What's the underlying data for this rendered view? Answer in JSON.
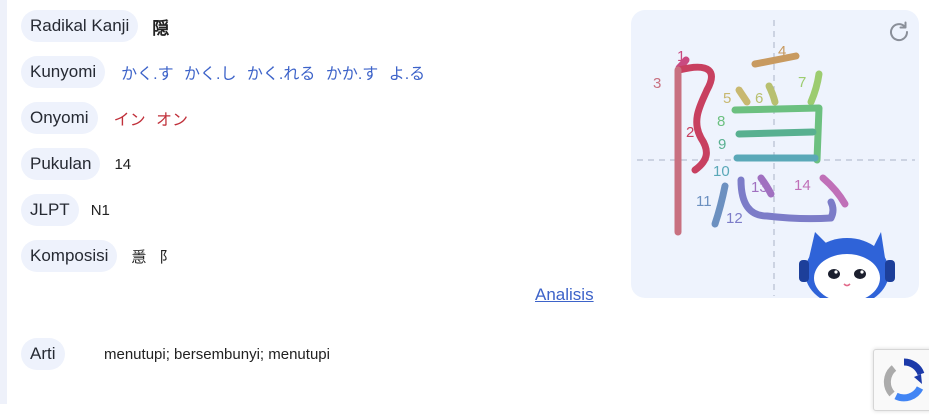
{
  "rows": {
    "radikal": {
      "label": "Radikal Kanji",
      "value": "隠"
    },
    "kunyomi": {
      "label": "Kunyomi",
      "value": "かく.す かく.し かく.れる かか.す よ.る"
    },
    "onyomi": {
      "label": "Onyomi",
      "value": "イン オン"
    },
    "pukulan": {
      "label": "Pukulan",
      "value": "14"
    },
    "jlpt": {
      "label": "JLPT",
      "value": "N1"
    },
    "komposisi": {
      "label": "Komposisi",
      "value": "㥯 阝"
    }
  },
  "analisis_link": "Analisis",
  "arti": {
    "label": "Arti",
    "value": "menutupi; bersembunyi; menutupi"
  },
  "stroke_numbers": [
    "1",
    "2",
    "3",
    "4",
    "5",
    "6",
    "7",
    "8",
    "9",
    "10",
    "11",
    "12",
    "13",
    "14"
  ],
  "icons": {
    "replay": "replay-icon",
    "mascot": "robot-cat-mascot",
    "recaptcha": "recaptcha-logo"
  },
  "colors": {
    "pill_bg": "#eef2fc",
    "kunyomi": "#3d63c9",
    "onyomi": "#c0303a",
    "panel_bg": "#eef3fd"
  }
}
